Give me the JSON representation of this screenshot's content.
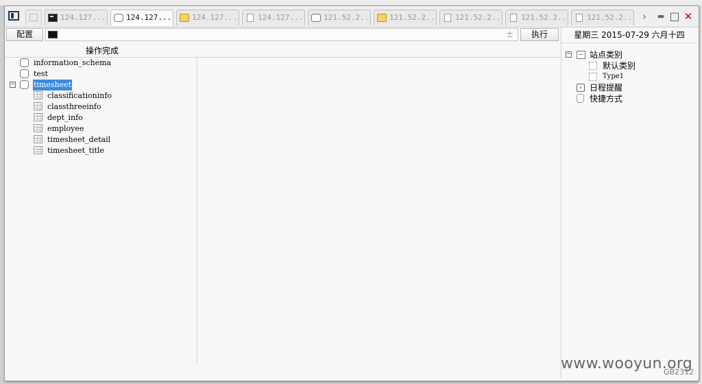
{
  "tabs": [
    {
      "label": "124.127....",
      "icon": "terminal-icon",
      "active": false
    },
    {
      "label": "124.127....",
      "icon": "database-icon",
      "active": true
    },
    {
      "label": "124.127....",
      "icon": "folder-icon",
      "active": false
    },
    {
      "label": "124.127....",
      "icon": "file-icon",
      "active": false
    },
    {
      "label": "121.52.2...",
      "icon": "database-icon",
      "active": false
    },
    {
      "label": "121.52.2...",
      "icon": "folder-icon",
      "active": false
    },
    {
      "label": "121.52.2...",
      "icon": "file-icon",
      "active": false
    },
    {
      "label": "121.52.2...",
      "icon": "file-icon",
      "active": false
    },
    {
      "label": "121.52.2...",
      "icon": "file-icon",
      "active": false
    }
  ],
  "window_controls": {
    "more": "›",
    "minimize": "▬",
    "maximize": "□",
    "close": "✕"
  },
  "toolbar": {
    "config_label": "配置",
    "input_value": "",
    "add_symbol": "±",
    "execute_label": "执行"
  },
  "status": {
    "message": "操作完成"
  },
  "tree": {
    "databases": [
      {
        "name": "information_schema",
        "expanded": false,
        "selected": false
      },
      {
        "name": "test",
        "expanded": false,
        "selected": false
      },
      {
        "name": "timesheet",
        "expanded": true,
        "selected": true,
        "expander": "−",
        "tables": [
          "classificationinfo",
          "classthreeinfo",
          "dept_info",
          "employee",
          "timesheet_detail",
          "timesheet_title"
        ]
      }
    ]
  },
  "right_panel": {
    "date": "星期三  2015-07-29  六月十四",
    "site_categories": {
      "label": "站点类别",
      "expander": "−",
      "items": [
        "默认类别",
        "Type1"
      ]
    },
    "reminder": "日程提醒",
    "shortcut": "快捷方式"
  },
  "watermark": "www.wooyun.org",
  "corner_tag": "GB2312",
  "colors": {
    "selection": "#3b8be0",
    "close": "#cc0000",
    "accent_dark": "#1f3a5a"
  }
}
